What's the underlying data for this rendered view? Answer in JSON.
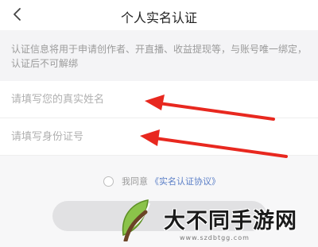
{
  "header": {
    "title": "个人实名认证",
    "back_icon": "chevron-left-icon"
  },
  "notice": {
    "text": "认证信息将用于申请创作者、开直播、收益提现等，与账号唯一绑定，认证后不可解绑"
  },
  "form": {
    "name_placeholder": "请填写您的真实姓名",
    "name_value": "",
    "id_placeholder": "请填写身份证号",
    "id_value": ""
  },
  "agreement": {
    "checked": false,
    "prefix": "我同意",
    "link": "《实名认证协议》"
  },
  "submit": {
    "label": "",
    "color": "#e1e1e3"
  },
  "annotations": {
    "arrow_color": "#e8281f",
    "arrow_targets": [
      "name-input",
      "id-number-input"
    ]
  },
  "watermark": {
    "logo_icon": "leaf-logo-icon",
    "text": "大不同手游网",
    "url": "www.szdbtgg.com"
  },
  "colors": {
    "background": "#ffffff",
    "notice_bg": "#f4f4f6",
    "link": "#5b7fc7"
  }
}
